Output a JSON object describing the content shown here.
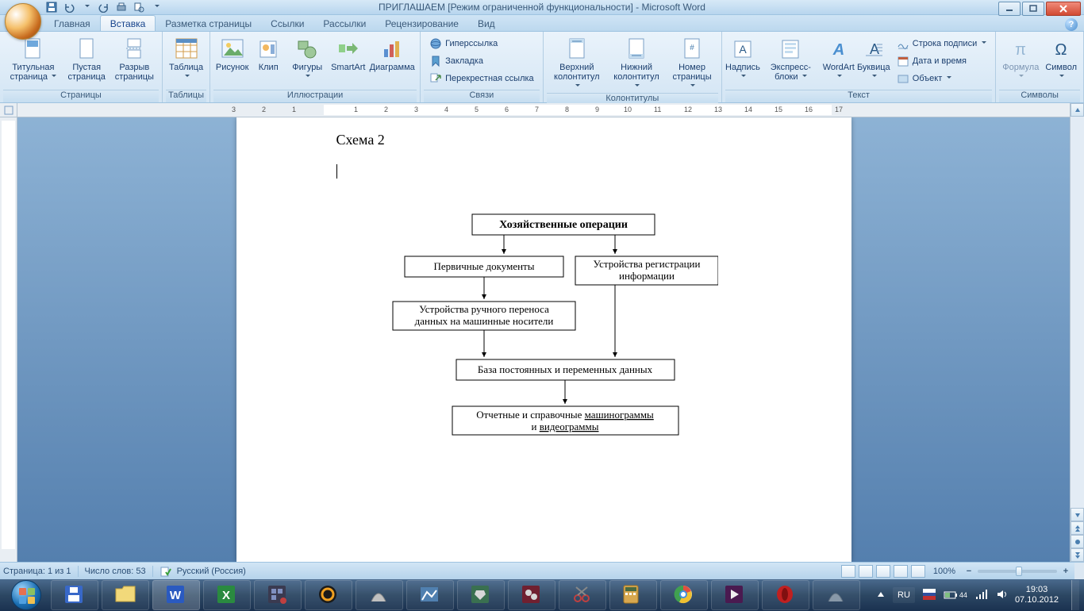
{
  "title": "ПРИГЛАШАЕМ [Режим ограниченной функциональности] - Microsoft Word",
  "tabs": [
    "Главная",
    "Вставка",
    "Разметка страницы",
    "Ссылки",
    "Рассылки",
    "Рецензирование",
    "Вид"
  ],
  "active_tab": 1,
  "ribbon": {
    "pages": {
      "label": "Страницы",
      "cover": "Титульная страница",
      "blank": "Пустая страница",
      "break": "Разрыв страницы"
    },
    "tables": {
      "label": "Таблицы",
      "table": "Таблица"
    },
    "illus": {
      "label": "Иллюстрации",
      "pic": "Рисунок",
      "clip": "Клип",
      "shapes": "Фигуры",
      "smart": "SmartArt",
      "chart": "Диаграмма"
    },
    "links": {
      "label": "Связи",
      "hyper": "Гиперссылка",
      "book": "Закладка",
      "cross": "Перекрестная ссылка"
    },
    "hf": {
      "label": "Колонтитулы",
      "header": "Верхний колонтитул",
      "footer": "Нижний колонтитул",
      "num": "Номер страницы"
    },
    "text": {
      "label": "Текст",
      "textbox": "Надпись",
      "quick": "Экспресс-блоки",
      "wordart": "WordArt",
      "dropcap": "Буквица",
      "sig": "Строка подписи",
      "date": "Дата и время",
      "obj": "Объект"
    },
    "sym": {
      "label": "Символы",
      "eq": "Формула",
      "symbol": "Символ"
    }
  },
  "doc": {
    "heading": "Схема 2",
    "box1": "Хозяйственные операции",
    "box2": "Первичные документы",
    "box3": "Устройства регистрации информации",
    "box4": "Устройства ручного переноса данных на машинные носители",
    "box5": "База постоянных и переменных данных",
    "box6a": "Отчетные и справочные ",
    "box6b": "машинограммы",
    "box6c": " и ",
    "box6d": "видеограммы"
  },
  "status": {
    "page": "Страница: 1 из 1",
    "words": "Число слов: 53",
    "lang": "Русский (Россия)",
    "zoom": "100%"
  },
  "tray": {
    "lang": "RU",
    "battery": "44",
    "time": "19:03",
    "date": "07.10.2012"
  }
}
